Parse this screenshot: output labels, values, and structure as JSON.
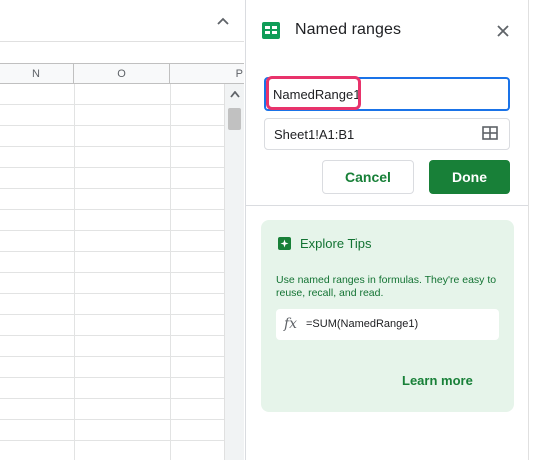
{
  "sheet": {
    "columns": [
      "N",
      "O",
      "P"
    ],
    "collapse_icon": "chevron-up-icon",
    "scroll_up_icon": "triangle-up-icon"
  },
  "panel": {
    "title": "Named ranges",
    "title_icon": "sheets-icon",
    "close_icon": "close-icon",
    "name_field": {
      "value": "NamedRange1"
    },
    "range_field": {
      "value": "Sheet1!A1:B1",
      "icon": "select-range-grid-icon"
    },
    "cancel_label": "Cancel",
    "done_label": "Done"
  },
  "tips": {
    "icon": "explore-tips-icon",
    "title": "Explore Tips",
    "text": "Use named ranges in formulas. They're easy to reuse, recall, and read.",
    "formula_icon": "fx",
    "formula": "=SUM(NamedRange1)",
    "learn_more": "Learn more"
  },
  "colors": {
    "accent_green": "#188038",
    "tips_background": "#e6f4ea",
    "focus_blue": "#1a73e8",
    "highlight_pink": "#e8336b"
  }
}
